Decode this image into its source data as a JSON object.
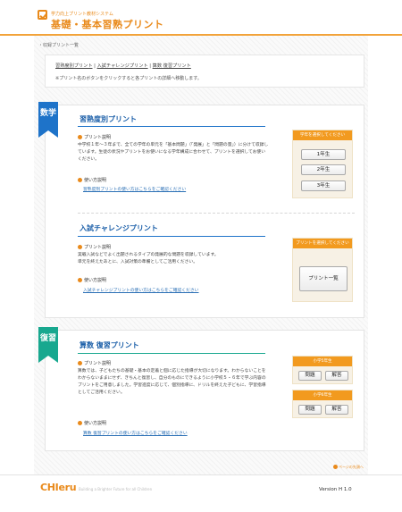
{
  "header": {
    "system_name": "学力向上プリント教材システム",
    "title": "基礎・基本習熟プリント"
  },
  "breadcrumb": "・収録プリント一覧",
  "nav": {
    "links": [
      "習熟度別プリント",
      "入試チャレンジプリント",
      "算数 復習プリント"
    ],
    "separator": " | ",
    "note": "※プリント名のボタンをクリックすると各プリントの詳細へ移動します。"
  },
  "math_card": {
    "tag": "数学",
    "section1": {
      "title": "習熟度別プリント",
      "desc_label": "プリント説明",
      "desc": "中学校１年～３年まで、全ての学年の単元を「基本問題」（「発展」と「問題の量」）に分けて収録しています。生徒の状況やプリントをお使いになる学年構成に合わせて、プリントを選択してお使いください。",
      "usage_label": "使い方説明",
      "usage_link": "習熟度別プリントの使い方はこちらをご確認ください",
      "panel_head": "学年を選択してください",
      "buttons": [
        "1年生",
        "2年生",
        "3年生"
      ]
    },
    "section2": {
      "title": "入試チャレンジプリント",
      "desc_label": "プリント説明",
      "desc": "実戦入試などでよく出題されるタイプの発展的な問題を収録しています。\n単元を終えたあとに、入試対策の準備としてご活用ください。",
      "usage_label": "使い方説明",
      "usage_link": "入試チャレンジプリントの使い方はこちらをご確認ください",
      "panel_head": "プリントを選択してください",
      "button": "プリント一覧"
    }
  },
  "review_card": {
    "tag": "復習",
    "title": "算数 復習プリント",
    "desc_label": "プリント説明",
    "desc": "算数では、子どもたちの基礎・基本の定着と個に応じた指導が大切になります。わからないことをわからないままにせず、きちんと復習し、自分のものにできるように小学校５・６年で学ぶ内容のプリントをご用意しました。学習進度に応じて、個別指導に、ドリルを終えた子どもに、学習指導としてご活用ください。",
    "usage_label": "使い方説明",
    "usage_link": "算数 復習プリントの使い方はこちらをご確認ください",
    "grade5_head": "小学5年生",
    "grade6_head": "小学6年生",
    "problems_label": "問題",
    "answers_label": "解答"
  },
  "footer": {
    "logo": "CHIeru",
    "tagline": "Building a Brighter Future for all Children",
    "version": "Version H 1.0",
    "page_top": "ページの先頭へ"
  },
  "colors": {
    "brand_orange": "#e98a1b",
    "math_blue": "#1e73c9",
    "review_teal": "#18a88f"
  }
}
